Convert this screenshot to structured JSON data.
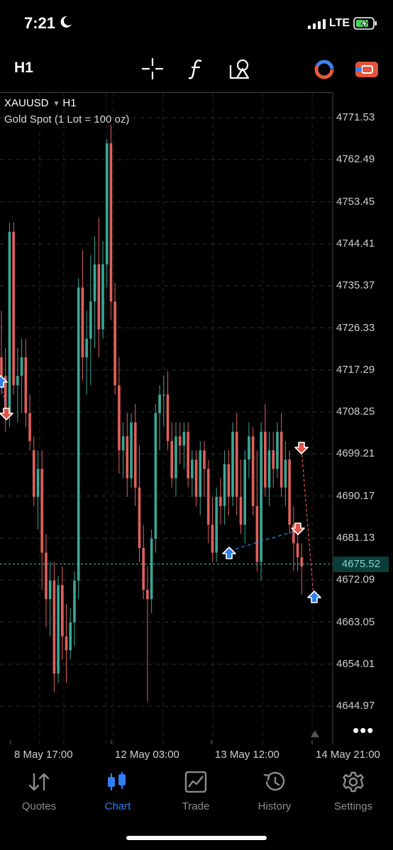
{
  "status_bar": {
    "time": "7:21",
    "network": "LTE"
  },
  "toolbar": {
    "timeframe": "H1",
    "tools": [
      "crosshair-icon",
      "indicators-icon",
      "objects-icon"
    ],
    "right_icons": [
      "signals-icon",
      "account-icon"
    ]
  },
  "chart": {
    "symbol": "XAUUSD",
    "timeframe": "H1",
    "description": "Gold Spot (1 Lot = 100 oz)",
    "price_labels": [
      "4771.53",
      "4762.49",
      "4753.45",
      "4744.41",
      "4735.37",
      "4726.33",
      "4717.29",
      "4708.25",
      "4699.21",
      "4690.17",
      "4681.13",
      "4672.09",
      "4663.05",
      "4654.01",
      "4644.97"
    ],
    "current_price": "4675.52",
    "date_labels": [
      "8 May 17:00",
      "12 May 03:00",
      "13 May 12:00",
      "14 May 21:00"
    ],
    "colors": {
      "bull": "#3aa796",
      "bear": "#e0605c",
      "buy_arrow": "#2f80ed",
      "sell_arrow": "#e05548",
      "bid_line": "#4fc3b5"
    }
  },
  "nav": {
    "items": [
      {
        "label": "Quotes",
        "icon": "quotes-icon"
      },
      {
        "label": "Chart",
        "icon": "chart-icon",
        "active": true
      },
      {
        "label": "Trade",
        "icon": "trade-icon"
      },
      {
        "label": "History",
        "icon": "history-icon"
      },
      {
        "label": "Settings",
        "icon": "settings-icon"
      }
    ]
  }
}
